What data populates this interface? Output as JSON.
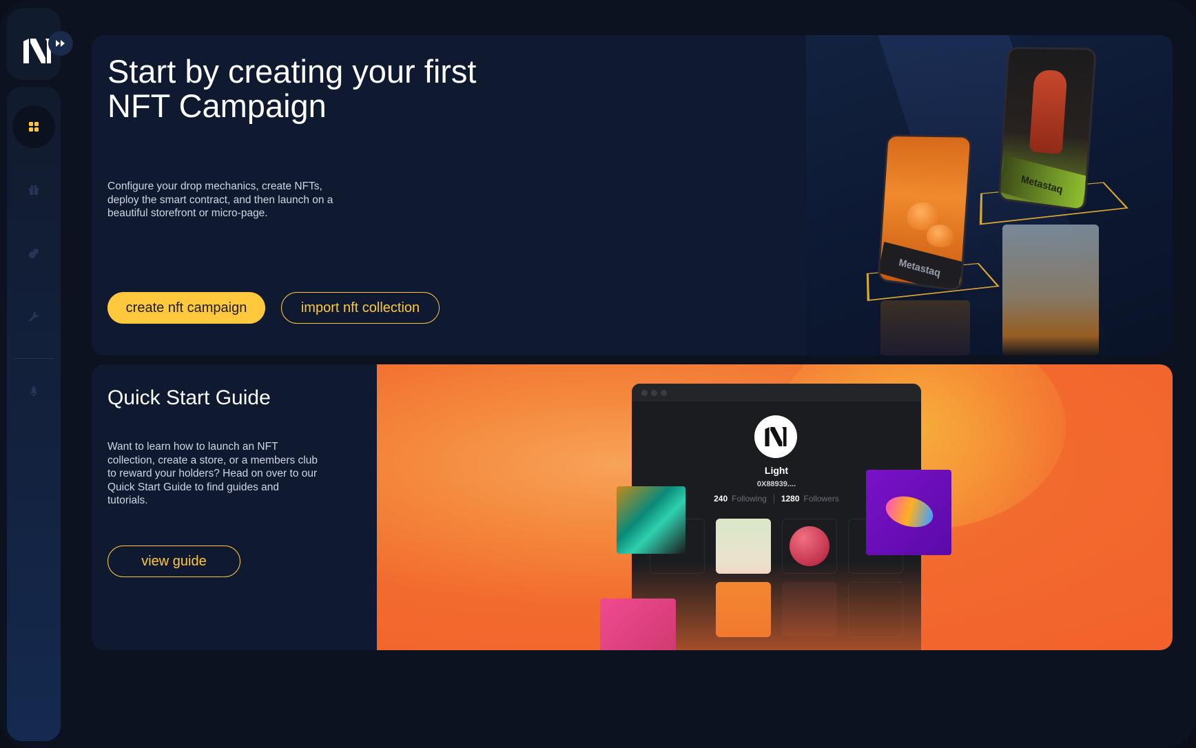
{
  "app": {
    "logo_icon": "brand-logo-icon",
    "expand_icon": "double-chevron-right-icon"
  },
  "sidebar": {
    "items": [
      {
        "icon": "dashboard-grid-icon",
        "active": true
      },
      {
        "icon": "gift-icon",
        "active": false
      },
      {
        "icon": "coins-icon",
        "active": false
      },
      {
        "icon": "wrench-icon",
        "active": false
      },
      {
        "icon": "rocket-icon",
        "active": false
      }
    ]
  },
  "hero": {
    "title": "Start by creating your first NFT Campaign",
    "description": "Configure your drop mechanics, create NFTs, deploy the smart contract, and then launch on a beautiful storefront or micro-page.",
    "primary_button": "create nft campaign",
    "secondary_button": "import nft collection",
    "card_labels": [
      "Metastaq",
      "Metastaq"
    ]
  },
  "guide": {
    "title": "Quick Start Guide",
    "description": "Want to learn how to launch an NFT collection, create a store, or a members club to reward your holders? Head on over to our Quick Start Guide to find guides and tutorials.",
    "button": "view guide",
    "mockup": {
      "profile_name": "Light",
      "address": "0X88939....",
      "following_count": "240",
      "following_label": "Following",
      "followers_count": "1280",
      "followers_label": "Followers"
    }
  },
  "colors": {
    "accent": "#ffc83d",
    "background": "#0c1220",
    "card": "#0f1a30",
    "orange": "#f26a2e"
  }
}
